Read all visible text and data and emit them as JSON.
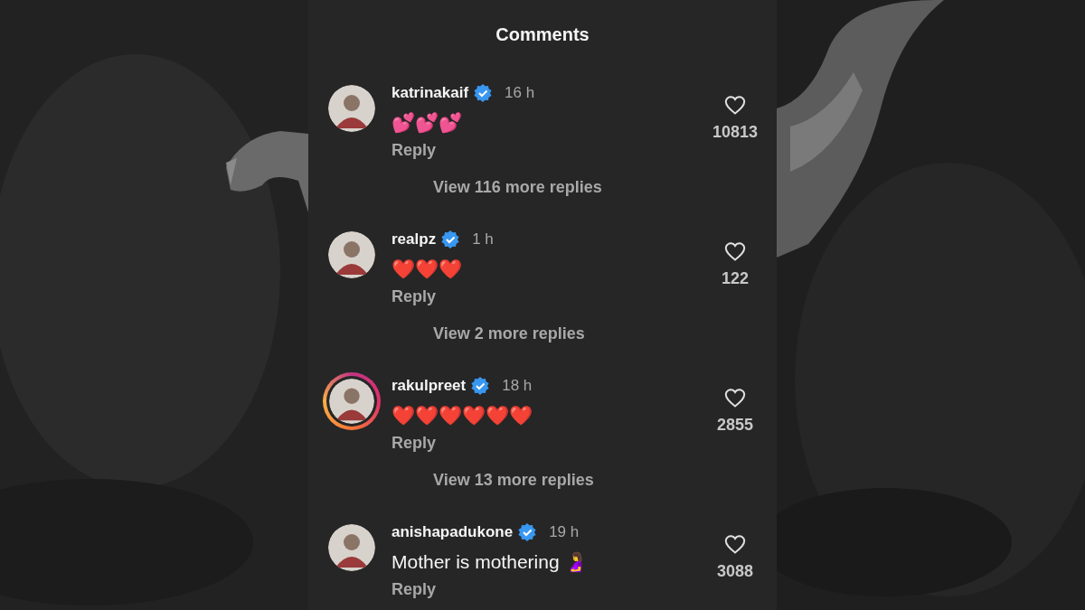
{
  "header": {
    "title": "Comments"
  },
  "comments": [
    {
      "username": "katrinakaif",
      "verified": true,
      "story_ring": false,
      "time": "16 h",
      "text": "💕💕💕",
      "reply": "Reply",
      "likes": "10813",
      "liked": false,
      "more_replies": "View 116 more replies"
    },
    {
      "username": "realpz",
      "verified": true,
      "story_ring": false,
      "time": "1 h",
      "text": "❤️❤️❤️",
      "reply": "Reply",
      "likes": "122",
      "liked": false,
      "more_replies": "View 2 more replies"
    },
    {
      "username": "rakulpreet",
      "verified": true,
      "story_ring": true,
      "time": "18 h",
      "text": "❤️❤️❤️❤️❤️❤️",
      "reply": "Reply",
      "likes": "2855",
      "liked": false,
      "more_replies": "View 13 more replies"
    },
    {
      "username": "anishapadukone",
      "verified": true,
      "story_ring": false,
      "time": "19 h",
      "text": "Mother is mothering 🤰",
      "reply": "Reply",
      "likes": "3088",
      "liked": false
    }
  ]
}
